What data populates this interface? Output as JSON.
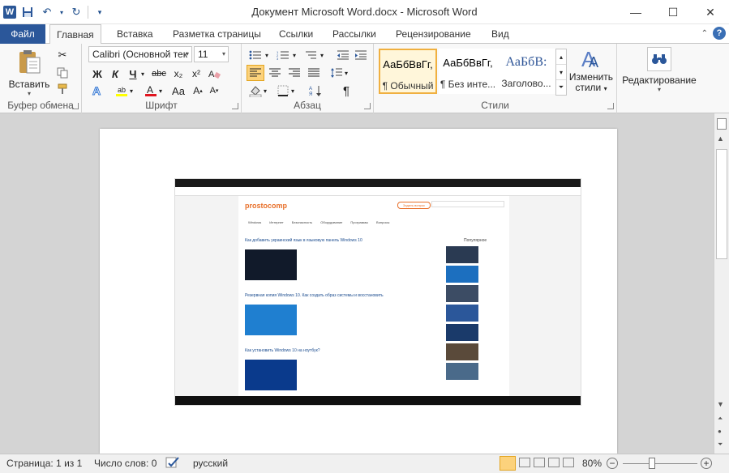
{
  "window": {
    "title": "Документ Microsoft Word.docx - Microsoft Word",
    "app_icon": "W",
    "controls": [
      "minimize",
      "maximize",
      "close"
    ]
  },
  "ribbon_tabs": {
    "file": "Файл",
    "items": [
      "Главная",
      "Вставка",
      "Разметка страницы",
      "Ссылки",
      "Рассылки",
      "Рецензирование",
      "Вид"
    ],
    "active": "Главная"
  },
  "clipboard": {
    "paste_label": "Вставить",
    "group_label": "Буфер обмена"
  },
  "font": {
    "name": "Calibri (Основной тек",
    "size": "11",
    "group_label": "Шрифт",
    "bold": "Ж",
    "italic": "К",
    "underline": "Ч",
    "strike": "abc",
    "subscript": "x₂",
    "superscript": "x²"
  },
  "paragraph": {
    "group_label": "Абзац",
    "pilcrow": "¶"
  },
  "styles": {
    "group_label": "Стили",
    "items": [
      {
        "sample": "АаБбВвГг,",
        "name": "¶ Обычный"
      },
      {
        "sample": "АаБбВвГг,",
        "name": "¶ Без инте..."
      },
      {
        "sample": "АаБбВ:",
        "name": "Заголово..."
      }
    ],
    "change_label": "Изменить",
    "change_label2": "стили"
  },
  "editing": {
    "label": "Редактирование"
  },
  "embedded_screenshot": {
    "site_logo": "prostocomp",
    "ask_button": "Задать вопрос",
    "nav": [
      "Windows",
      "Интернет",
      "Безопасность",
      "Оборудование",
      "Программы",
      "Вопросы"
    ],
    "popular_heading": "Популярное",
    "articles": [
      "Как добавить украинский язык в языковую панель Windows 10",
      "Резервная копия Windows 10. Как создать образ системы и восстановить",
      "Как установить Windows 10 на ноутбук?"
    ]
  },
  "statusbar": {
    "page": "Страница: 1 из 1",
    "words": "Число слов: 0",
    "language": "русский",
    "zoom": "80%"
  }
}
